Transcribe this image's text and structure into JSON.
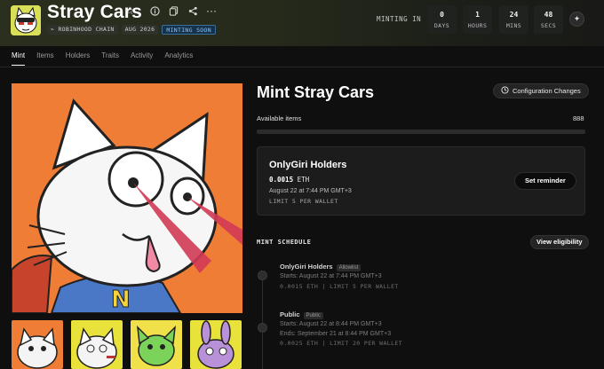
{
  "header": {
    "title": "Stray Cars",
    "tags": [
      "ROBINHOOD CHAIN",
      "AUG 2026",
      "MINTING SOON"
    ],
    "minting_in_label": "MINTING IN",
    "countdown": [
      {
        "value": "0",
        "unit": "DAYS"
      },
      {
        "value": "1",
        "unit": "HOURS"
      },
      {
        "value": "24",
        "unit": "MINS"
      },
      {
        "value": "48",
        "unit": "SECS"
      }
    ],
    "icons": [
      "star-icon",
      "info-icon",
      "copy-icon",
      "share-icon",
      "more-icon",
      "sparkle-icon"
    ]
  },
  "tabs": [
    "Mint",
    "Items",
    "Holders",
    "Traits",
    "Activity",
    "Analytics"
  ],
  "mint": {
    "title": "Mint Stray Cars",
    "config_button": "Configuration Changes",
    "available_label": "Available items",
    "available_value": "888",
    "progress_fraction": 0,
    "card": {
      "title": "OnlyGiri Holders",
      "price": "0.0015",
      "currency": "ETH",
      "date": "August 22 at 7:44 PM GMT+3",
      "limit": "LIMIT 5 PER WALLET",
      "reminder_button": "Set reminder"
    },
    "schedule_heading": "MINT SCHEDULE",
    "eligibility_button": "View eligibility",
    "phases": [
      {
        "name": "OnlyGiri Holders",
        "badge": "Allowlist",
        "starts": "Starts: August 22 at 7:44 PM GMT+3",
        "meta": "0.0015 ETH | LIMIT 5 PER WALLET"
      },
      {
        "name": "Public",
        "badge": "Public",
        "starts": "Starts: August 22 at 8:44 PM GMT+3",
        "ends": "Ends: September 21 at 8:44 PM GMT+3",
        "meta": "0.0025 ETH | LIMIT 20 PER WALLET"
      }
    ]
  },
  "colors": {
    "art_bg": "#ef7d36",
    "accent_blue": "#8fc4f2"
  }
}
